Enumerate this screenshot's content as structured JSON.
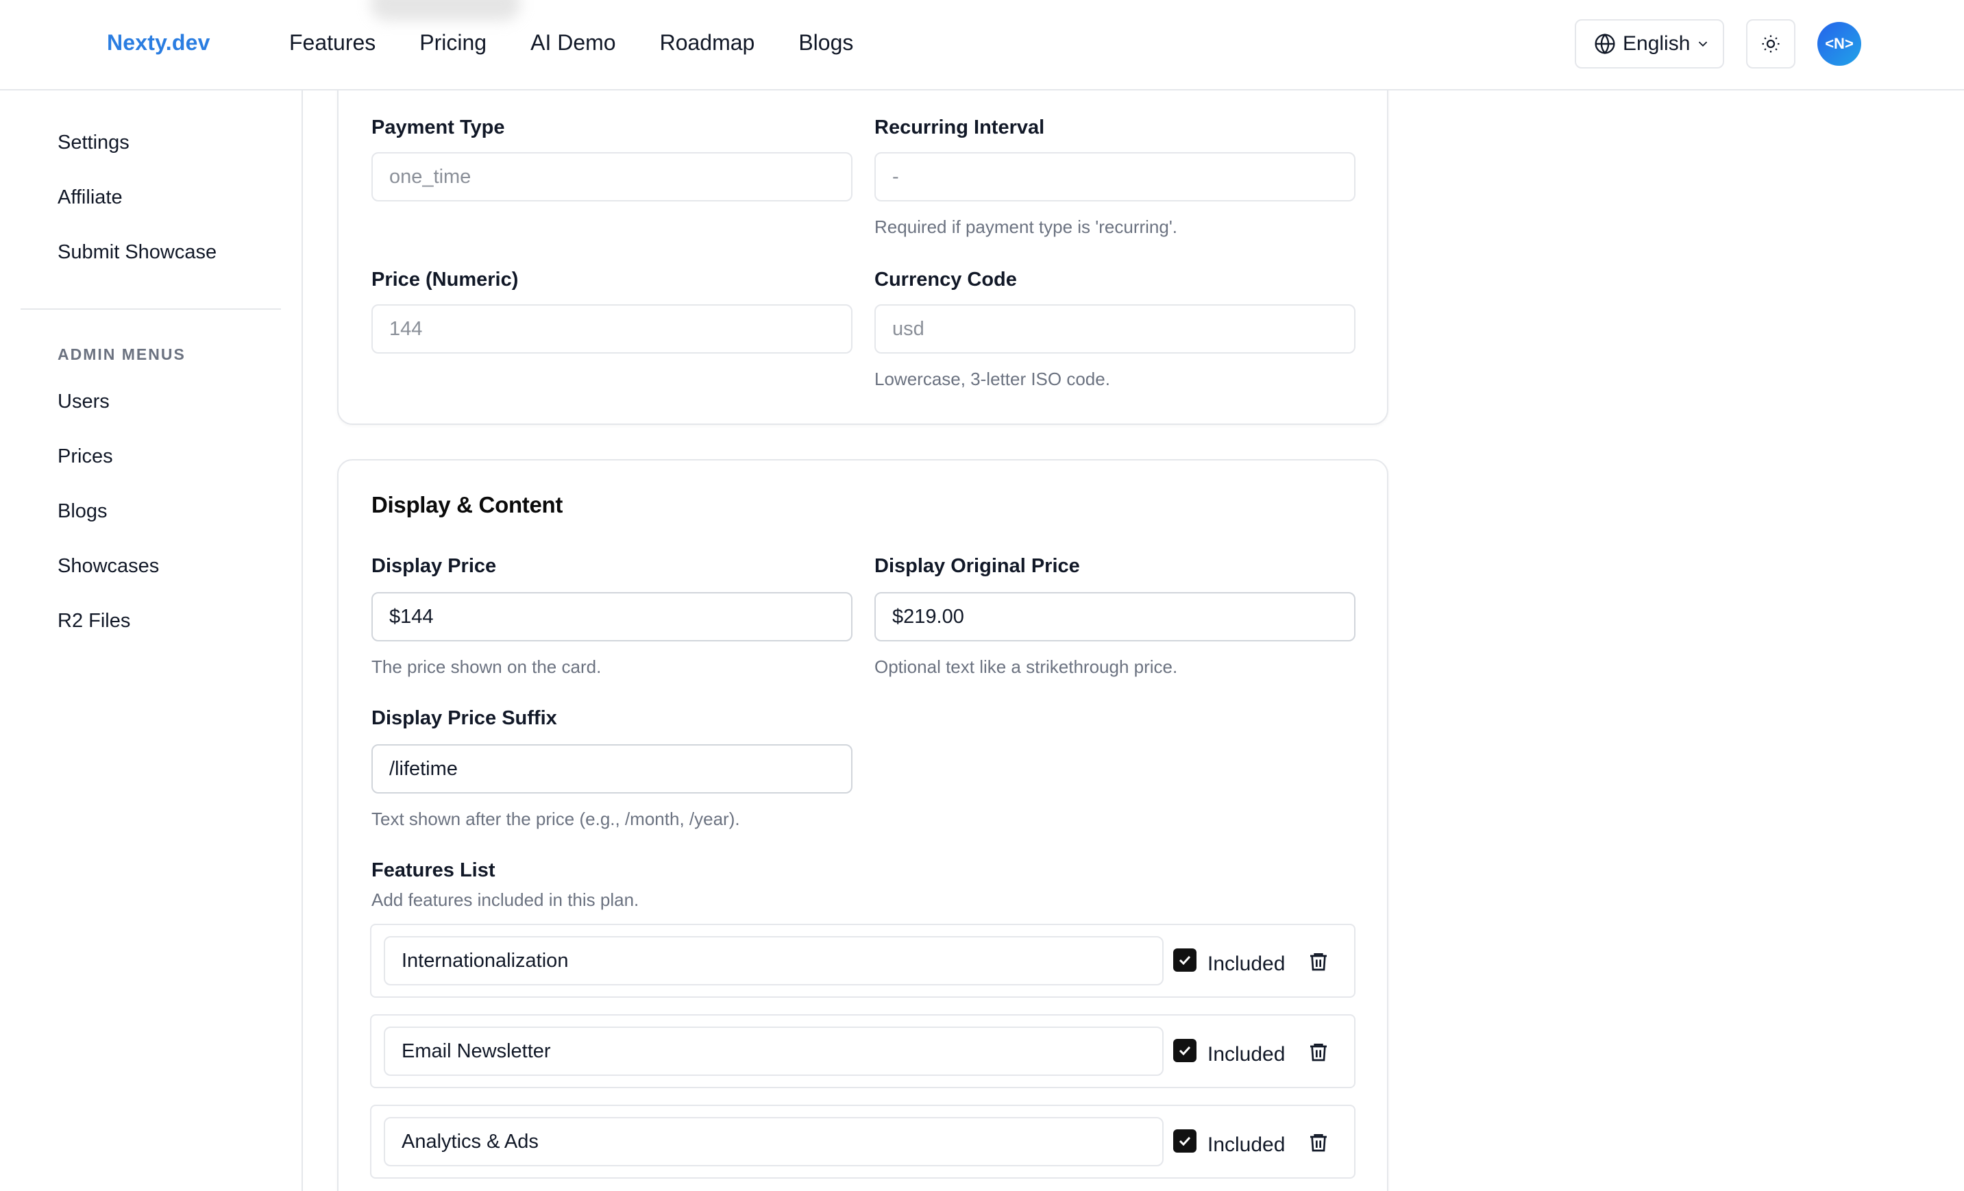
{
  "header": {
    "brand": "Nexty.dev",
    "nav": [
      "Features",
      "Pricing",
      "AI Demo",
      "Roadmap",
      "Blogs"
    ],
    "language": "English",
    "avatar_text": "<N>",
    "icons": {
      "language": "globe-icon",
      "language_chevron": "chevron-down-icon",
      "theme": "sun-icon"
    }
  },
  "sidebar": {
    "items": [
      "Settings",
      "Affiliate",
      "Submit Showcase"
    ],
    "admin_heading": "ADMIN MENUS",
    "admin_items": [
      "Users",
      "Prices",
      "Blogs",
      "Showcases",
      "R2 Files"
    ]
  },
  "payment": {
    "payment_type": {
      "label": "Payment Type",
      "value": "one_time"
    },
    "recurring_interval": {
      "label": "Recurring Interval",
      "value": "-",
      "help": "Required if payment type is 'recurring'."
    },
    "price": {
      "label": "Price (Numeric)",
      "value": "144"
    },
    "currency": {
      "label": "Currency Code",
      "value": "usd",
      "help": "Lowercase, 3-letter ISO code."
    }
  },
  "display": {
    "title": "Display & Content",
    "display_price": {
      "label": "Display Price",
      "value": "$144",
      "help": "The price shown on the card."
    },
    "display_original_price": {
      "label": "Display Original Price",
      "value": "$219.00",
      "help": "Optional text like a strikethrough price."
    },
    "display_price_suffix": {
      "label": "Display Price Suffix",
      "value": "/lifetime",
      "help": "Text shown after the price (e.g., /month, /year)."
    },
    "features": {
      "label": "Features List",
      "help": "Add features included in this plan.",
      "included_label": "Included",
      "items": [
        {
          "name": "Internationalization",
          "included": true
        },
        {
          "name": "Email Newsletter",
          "included": true
        },
        {
          "name": "Analytics & Ads",
          "included": true
        }
      ]
    }
  }
}
